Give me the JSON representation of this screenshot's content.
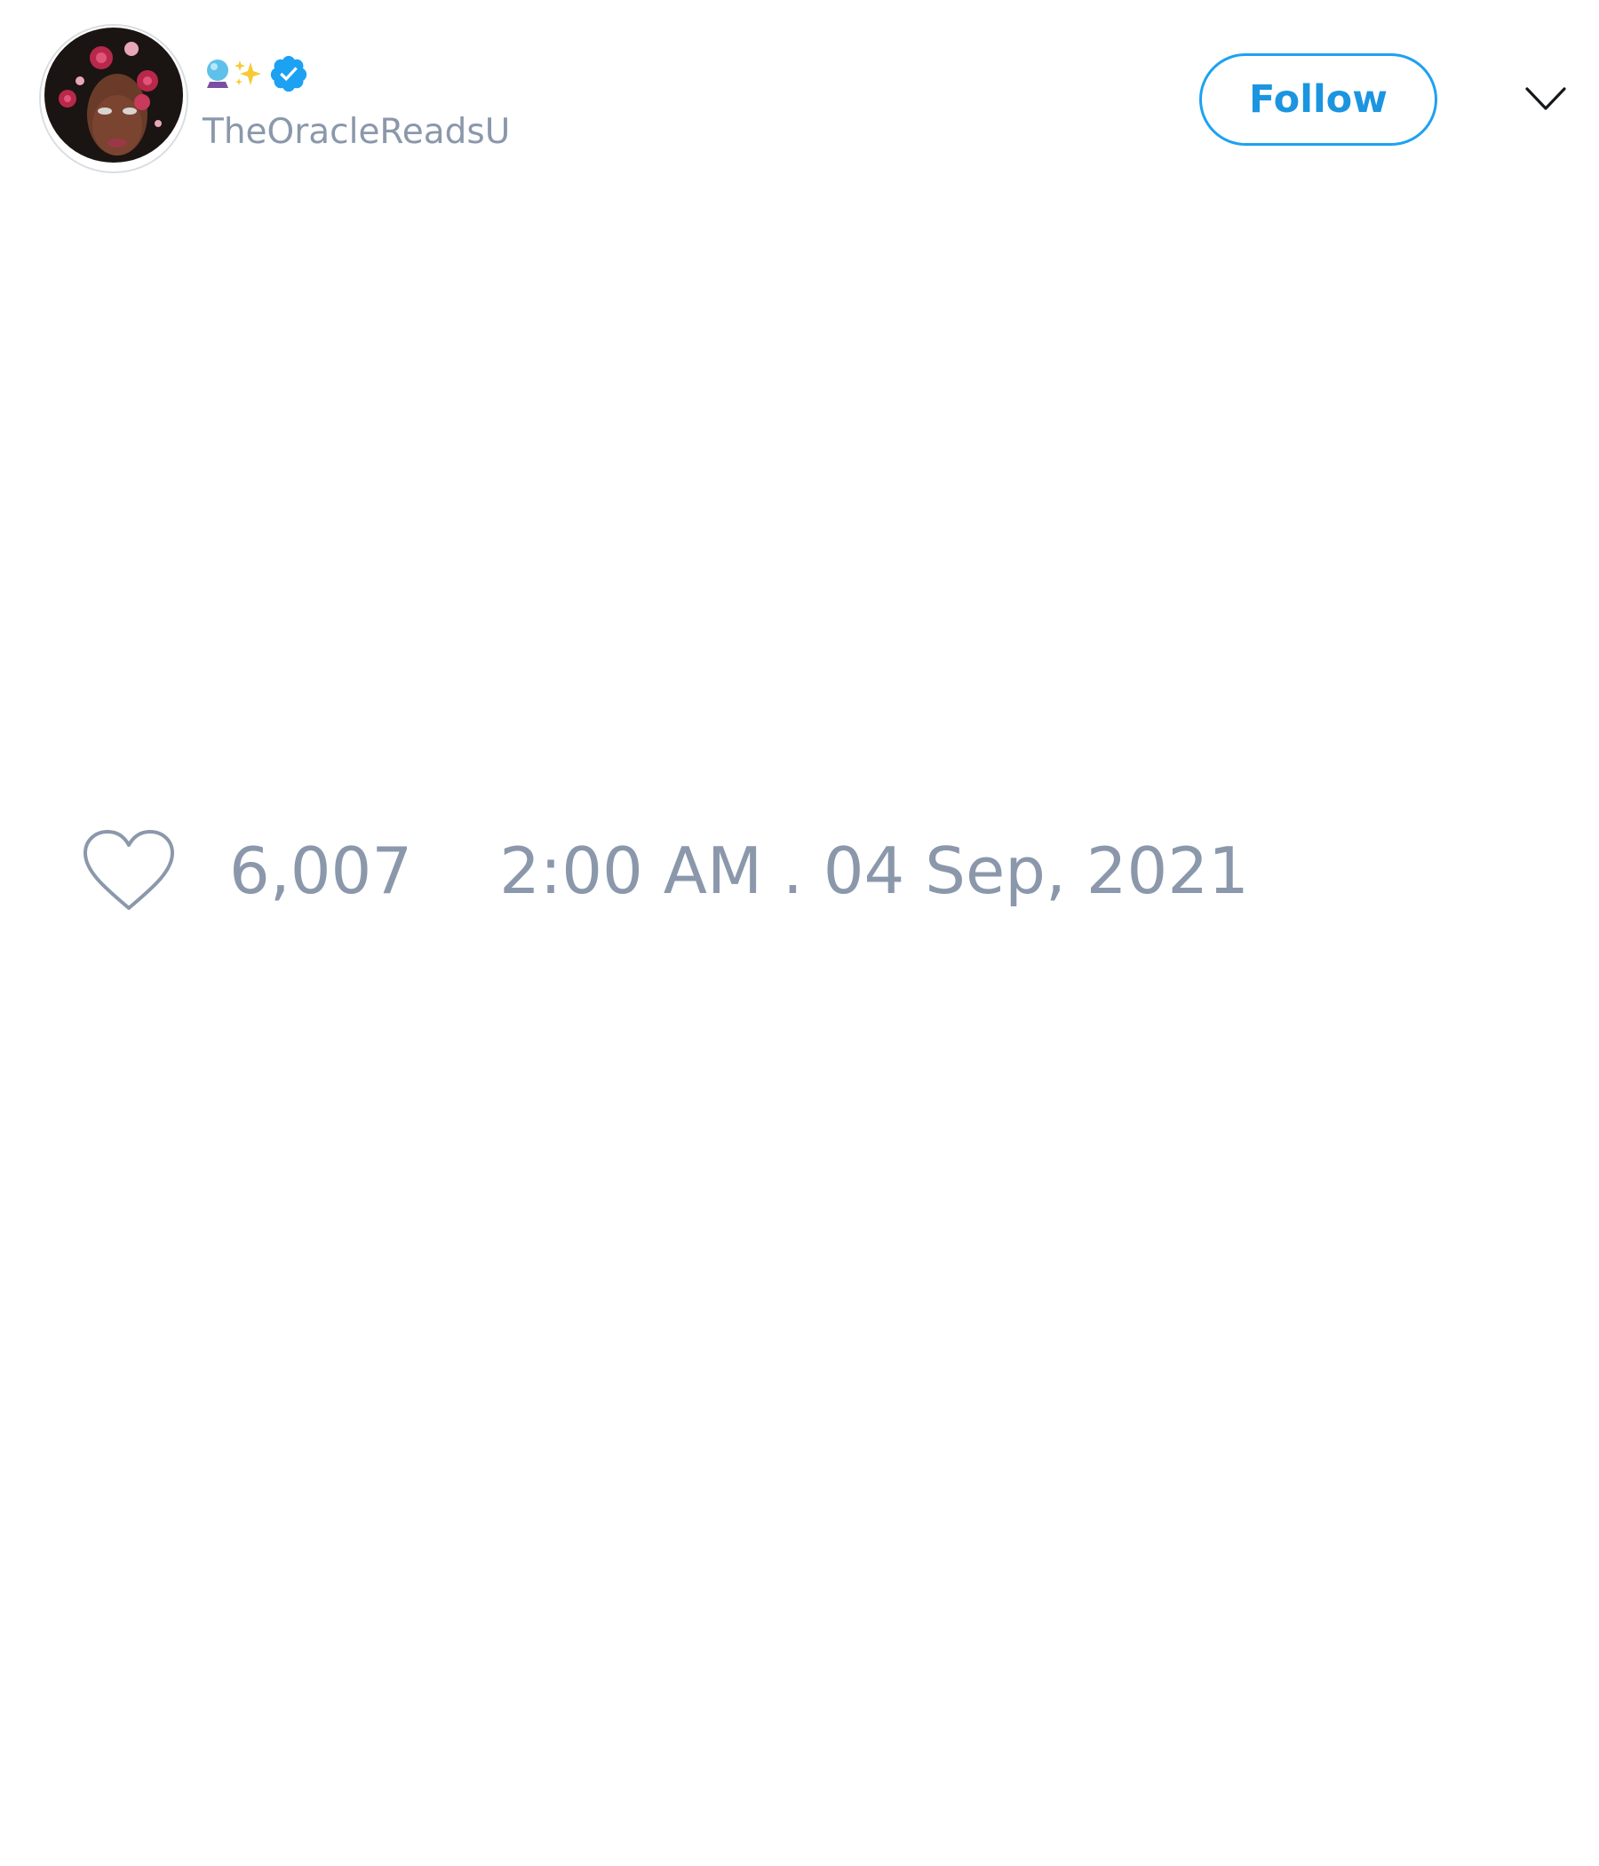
{
  "tweet": {
    "author": {
      "display_name_emojis": [
        "crystal-ball",
        "sparkles"
      ],
      "verified": true,
      "handle": "TheOracleReadsU"
    },
    "follow_label": "Follow",
    "like_count": "6,007",
    "timestamp": "2:00 AM . 04 Sep, 2021"
  },
  "icons": {
    "avatar": "profile-photo",
    "verified": "verified-badge-icon",
    "menu": "chevron-down-icon",
    "like": "heart-icon"
  },
  "colors": {
    "accent": "#1da1f2",
    "accent_text": "#1b95e0",
    "muted_text": "#8b98ab"
  }
}
